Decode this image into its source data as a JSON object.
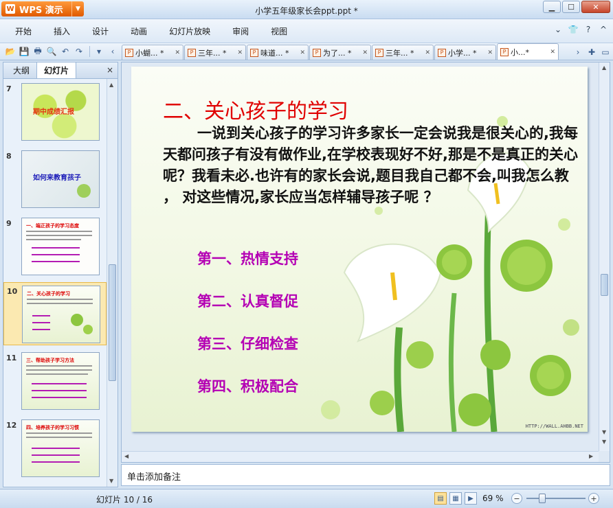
{
  "app": {
    "brand": "WPS 演示",
    "doc_title": "小学五年级家长会ppt.ppt *"
  },
  "menu": [
    "开始",
    "插入",
    "设计",
    "动画",
    "幻灯片放映",
    "审阅",
    "视图"
  ],
  "doc_tabs": [
    {
      "label": "小蝴... *"
    },
    {
      "label": "三年... *"
    },
    {
      "label": "味道... *"
    },
    {
      "label": "为了... *"
    },
    {
      "label": "三年... *"
    },
    {
      "label": "小学... *"
    },
    {
      "label": "小...*"
    }
  ],
  "left_panel": {
    "tab_outline": "大纲",
    "tab_slides": "幻灯片",
    "close": "×",
    "thumbnails": [
      {
        "num": "7",
        "title": "期中成绩汇报"
      },
      {
        "num": "8",
        "title": "如何来教育孩子"
      },
      {
        "num": "9",
        "title": "一、端正孩子的学习态度"
      },
      {
        "num": "10",
        "title": "二、关心孩子的学习"
      },
      {
        "num": "11",
        "title": "三、帮助孩子学习方法"
      },
      {
        "num": "12",
        "title": "四、培养孩子的学习习惯"
      }
    ]
  },
  "slide": {
    "title": "二、关心孩子的学习",
    "body": "一说到关心孩子的学习许多家长一定会说我是很关心的,我每天都问孩子有没有做作业,在学校表现好不好,那是不是真正的关心呢？我看未必.也许有的家长会说,题目我自己都不会,叫我怎么教 ， 对这些情况,家长应当怎样辅导孩子呢 ？",
    "points": [
      "第一、热情支持",
      "第二、认真督促",
      "第三、仔细检查",
      "第四、积极配合"
    ],
    "watermark": "HTTP://WALL.AHBB.NET"
  },
  "notes_placeholder": "单击添加备注",
  "status": {
    "slide_count": "幻灯片 10 / 16",
    "zoom": "69 %"
  },
  "colors": {
    "title_red": "#e00000",
    "point_purple": "#b400b4",
    "wps_orange": "#e05a00"
  }
}
